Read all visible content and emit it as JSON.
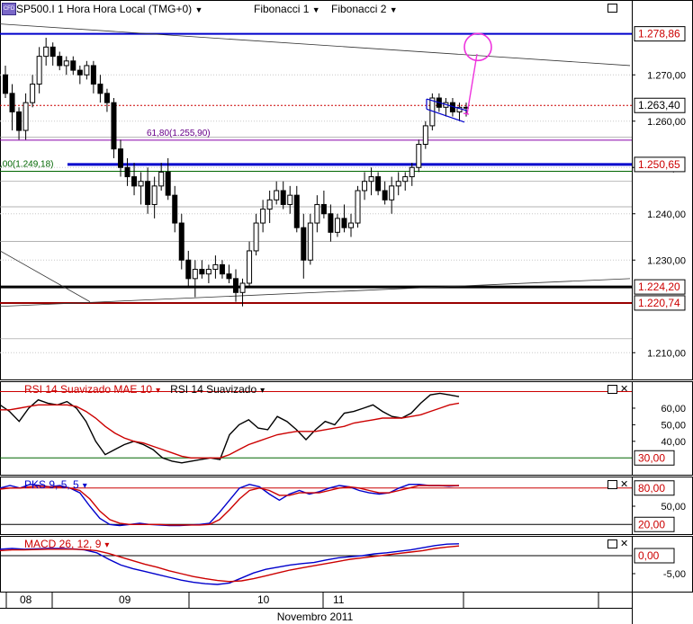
{
  "header": {
    "symbol": "SP500.I",
    "timeframe": "1 Hora",
    "timezone": "Hora Local (TMG+0)",
    "tools": [
      "Fibonacci 1",
      "Fibonacci 2"
    ]
  },
  "chart_data": [
    {
      "type": "candlestick",
      "name": "price",
      "ylim": [
        1205,
        1285
      ],
      "y_ticks": [
        1210,
        1230,
        1240,
        1250,
        1260,
        1270
      ],
      "y_tick_labels": [
        "1.210,00",
        "1.230,00",
        "1.240,00",
        "1.250,00",
        "1.260,00",
        "1.270,00"
      ],
      "price_tags": [
        {
          "label": "1.278,86",
          "value": 1278.86,
          "color": "#cc0000"
        },
        {
          "label": "1.263,40",
          "value": 1263.4,
          "color": "#000000"
        },
        {
          "label": "1.250,65",
          "value": 1250.65,
          "color": "#cc0000"
        },
        {
          "label": "1.224,20",
          "value": 1224.2,
          "color": "#cc0000"
        },
        {
          "label": "1.220,74",
          "value": 1220.74,
          "color": "#cc0000"
        }
      ],
      "horizontal_lines": [
        {
          "value": 1278.86,
          "color": "#0000cc",
          "width": 2
        },
        {
          "value": 1263.4,
          "color": "#cc0000",
          "style": "dotted"
        },
        {
          "value": 1250.65,
          "color": "#0000cc",
          "width": 3,
          "x_start": 75
        },
        {
          "value": 1224.2,
          "color": "#000000",
          "width": 3
        },
        {
          "value": 1220.74,
          "color": "#990000",
          "width": 2
        },
        {
          "value": 1255.9,
          "color": "#8800aa",
          "width": 1,
          "x_start": 0
        },
        {
          "value": 1249.18,
          "color": "#006600",
          "width": 1
        }
      ],
      "fib_labels": [
        {
          "text": "61,80(1.255,90)",
          "value": 1255.9,
          "color": "#660088"
        },
        {
          "text": ",00(1.249,18)",
          "value": 1249.18,
          "color": "#006600"
        }
      ],
      "candles": [
        [
          1270,
          1272,
          1265,
          1266
        ],
        [
          1266,
          1268,
          1258,
          1262
        ],
        [
          1262,
          1263,
          1256,
          1258
        ],
        [
          1258,
          1266,
          1256,
          1264
        ],
        [
          1264,
          1270,
          1263,
          1268
        ],
        [
          1268,
          1276,
          1266,
          1274
        ],
        [
          1274,
          1278,
          1272,
          1276
        ],
        [
          1276,
          1277,
          1272,
          1274
        ],
        [
          1274,
          1275,
          1271,
          1272
        ],
        [
          1272,
          1274,
          1270,
          1273
        ],
        [
          1273,
          1274,
          1270,
          1271
        ],
        [
          1271,
          1272,
          1268,
          1270
        ],
        [
          1270,
          1273,
          1269,
          1272
        ],
        [
          1272,
          1273,
          1266,
          1268
        ],
        [
          1268,
          1270,
          1264,
          1266
        ],
        [
          1266,
          1267,
          1262,
          1264
        ],
        [
          1264,
          1265,
          1252,
          1254
        ],
        [
          1254,
          1256,
          1248,
          1250
        ],
        [
          1250,
          1252,
          1246,
          1248
        ],
        [
          1248,
          1251,
          1244,
          1246
        ],
        [
          1246,
          1249,
          1242,
          1247
        ],
        [
          1247,
          1250,
          1240,
          1242
        ],
        [
          1242,
          1248,
          1239,
          1246
        ],
        [
          1246,
          1251,
          1245,
          1249
        ],
        [
          1249,
          1252,
          1243,
          1244
        ],
        [
          1244,
          1246,
          1236,
          1238
        ],
        [
          1238,
          1240,
          1228,
          1230
        ],
        [
          1230,
          1232,
          1224,
          1226
        ],
        [
          1226,
          1230,
          1222,
          1228
        ],
        [
          1228,
          1230,
          1226,
          1227
        ],
        [
          1227,
          1229,
          1225,
          1228
        ],
        [
          1228,
          1231,
          1226,
          1229
        ],
        [
          1229,
          1230,
          1226,
          1227
        ],
        [
          1227,
          1229,
          1225,
          1226
        ],
        [
          1226,
          1228,
          1221,
          1223
        ],
        [
          1223,
          1226,
          1220,
          1225
        ],
        [
          1225,
          1234,
          1224,
          1232
        ],
        [
          1232,
          1240,
          1231,
          1238
        ],
        [
          1238,
          1243,
          1236,
          1241
        ],
        [
          1241,
          1245,
          1238,
          1243
        ],
        [
          1243,
          1247,
          1242,
          1245
        ],
        [
          1245,
          1247,
          1241,
          1242
        ],
        [
          1242,
          1246,
          1240,
          1244
        ],
        [
          1244,
          1246,
          1236,
          1237
        ],
        [
          1237,
          1240,
          1226,
          1230
        ],
        [
          1230,
          1240,
          1229,
          1238
        ],
        [
          1238,
          1244,
          1236,
          1242
        ],
        [
          1242,
          1245,
          1239,
          1240
        ],
        [
          1240,
          1242,
          1234,
          1236
        ],
        [
          1236,
          1240,
          1235,
          1239
        ],
        [
          1239,
          1242,
          1236,
          1237
        ],
        [
          1237,
          1240,
          1235,
          1238
        ],
        [
          1238,
          1246,
          1237,
          1245
        ],
        [
          1245,
          1249,
          1243,
          1247
        ],
        [
          1247,
          1250,
          1244,
          1248
        ],
        [
          1248,
          1249,
          1244,
          1245
        ],
        [
          1245,
          1247,
          1242,
          1243
        ],
        [
          1243,
          1248,
          1240,
          1246
        ],
        [
          1246,
          1249,
          1244,
          1247
        ],
        [
          1247,
          1249,
          1245,
          1248
        ],
        [
          1248,
          1251,
          1246,
          1250
        ],
        [
          1250,
          1256,
          1249,
          1255
        ],
        [
          1255,
          1260,
          1254,
          1259
        ],
        [
          1259,
          1266,
          1258,
          1265
        ],
        [
          1265,
          1266,
          1262,
          1263
        ],
        [
          1263,
          1265,
          1261,
          1264
        ],
        [
          1264,
          1265,
          1261,
          1262
        ],
        [
          1262,
          1264,
          1260,
          1263
        ],
        [
          1263,
          1264,
          1261,
          1263
        ]
      ],
      "trend_lines": [
        {
          "from": [
            0,
            1281
          ],
          "to": [
            700,
            1272
          ],
          "color": "#333333"
        },
        {
          "from": [
            0,
            1220
          ],
          "to": [
            700,
            1226
          ],
          "color": "#333333"
        },
        {
          "from": [
            0,
            1232
          ],
          "to": [
            100,
            1221
          ],
          "color": "#333333"
        }
      ],
      "flag_channel": {
        "upper": [
          [
            474,
            1264.8
          ],
          [
            520,
            1262.2
          ]
        ],
        "lower": [
          [
            474,
            1262.6
          ],
          [
            516,
            1259.8
          ]
        ],
        "color": "#0000cc"
      },
      "projection": {
        "from": [
          519,
          1261.5
        ],
        "to": [
          530,
          1274.5
        ],
        "circle_center": [
          531,
          1276.0
        ],
        "circle_radius": 15,
        "color": "#ee33dd"
      }
    },
    {
      "type": "line",
      "name": "rsi",
      "title_parts": [
        "RSI 14 Suavizado MAE 10",
        "RSI 14 Suavizado"
      ],
      "title_colors": [
        "#cc0000",
        "#000000"
      ],
      "ylim": [
        22,
        73
      ],
      "y_ticks": [
        40,
        50,
        60
      ],
      "y_tick_labels": [
        "40,00",
        "50,00",
        "60,00"
      ],
      "level_tags": [
        {
          "label": "30,00",
          "value": 30,
          "color": "#cc0000"
        }
      ],
      "levels": [
        {
          "value": 70,
          "color": "#cc0000"
        },
        {
          "value": 30,
          "color": "#006600"
        }
      ],
      "series": [
        {
          "color": "#000000",
          "values": [
            62,
            58,
            52,
            60,
            65,
            63,
            62,
            64,
            60,
            52,
            40,
            32,
            35,
            38,
            40,
            38,
            35,
            30,
            28,
            27,
            28,
            29,
            30,
            29,
            44,
            50,
            53,
            48,
            47,
            55,
            52,
            47,
            41,
            47,
            52,
            50,
            57,
            58,
            60,
            62,
            58,
            55,
            54,
            57,
            63,
            68,
            69,
            68,
            67
          ]
        },
        {
          "color": "#cc0000",
          "values": [
            59,
            59,
            60,
            61,
            62,
            62,
            62,
            62,
            61,
            58,
            54,
            49,
            45,
            42,
            40,
            39,
            37,
            35,
            33,
            31,
            30,
            30,
            30,
            30,
            32,
            35,
            38,
            40,
            42,
            44,
            45,
            46,
            46,
            46,
            47,
            48,
            49,
            51,
            52,
            53,
            54,
            54,
            54,
            55,
            56,
            58,
            60,
            62,
            63
          ]
        }
      ]
    },
    {
      "type": "line",
      "name": "pks",
      "title_parts": [
        "PKS 9, 5, 5"
      ],
      "title_colors": [
        "#0000cc"
      ],
      "ylim": [
        10,
        90
      ],
      "y_ticks": [
        50
      ],
      "y_tick_labels": [
        "50,00"
      ],
      "level_tags": [
        {
          "label": "80,00",
          "value": 80,
          "color": "#cc0000"
        },
        {
          "label": "20,00",
          "value": 20,
          "color": "#cc0000"
        }
      ],
      "levels": [
        {
          "value": 80,
          "color": "#cc0000"
        },
        {
          "value": 20,
          "color": "#000000"
        }
      ],
      "series": [
        {
          "color": "#0000cc",
          "values": [
            80,
            84,
            80,
            86,
            84,
            82,
            84,
            80,
            72,
            50,
            30,
            20,
            18,
            20,
            22,
            20,
            19,
            18,
            18,
            19,
            20,
            22,
            40,
            60,
            80,
            86,
            82,
            70,
            60,
            70,
            76,
            70,
            74,
            80,
            84,
            82,
            76,
            72,
            70,
            72,
            80,
            86,
            86,
            84,
            84,
            83,
            84
          ]
        },
        {
          "color": "#cc0000",
          "values": [
            78,
            80,
            80,
            82,
            83,
            82,
            82,
            80,
            76,
            62,
            42,
            28,
            22,
            20,
            20,
            20,
            20,
            19,
            19,
            19,
            19,
            20,
            28,
            44,
            62,
            76,
            80,
            76,
            68,
            68,
            72,
            72,
            72,
            76,
            80,
            82,
            80,
            76,
            72,
            72,
            76,
            80,
            84,
            84,
            84,
            84,
            84
          ]
        }
      ]
    },
    {
      "type": "line",
      "name": "macd",
      "title_parts": [
        "MACD 26, 12, 9"
      ],
      "title_colors": [
        "#cc0000"
      ],
      "ylim": [
        -9,
        4
      ],
      "y_ticks": [
        -5
      ],
      "y_tick_labels": [
        "-5,00"
      ],
      "level_tags": [
        {
          "label": "0,00",
          "value": 0,
          "color": "#cc0000"
        }
      ],
      "levels": [
        {
          "value": 0,
          "color": "#000000"
        }
      ],
      "series": [
        {
          "color": "#0000cc",
          "values": [
            1.8,
            2.0,
            1.8,
            1.9,
            2.0,
            2.0,
            1.9,
            1.6,
            0.8,
            -1.0,
            -2.6,
            -3.6,
            -4.4,
            -5.2,
            -6.0,
            -6.8,
            -7.4,
            -7.8,
            -8.0,
            -7.6,
            -6.2,
            -4.8,
            -3.8,
            -3.2,
            -2.6,
            -2.2,
            -1.9,
            -1.2,
            -0.6,
            -0.3,
            0.0,
            0.5,
            0.8,
            1.2,
            1.6,
            2.2,
            2.8,
            3.2,
            3.3
          ]
        },
        {
          "color": "#cc0000",
          "values": [
            1.4,
            1.6,
            1.6,
            1.7,
            1.8,
            1.8,
            1.8,
            1.7,
            1.4,
            0.6,
            -0.4,
            -1.4,
            -2.4,
            -3.2,
            -4.2,
            -5.0,
            -5.8,
            -6.4,
            -6.9,
            -7.2,
            -7.0,
            -6.4,
            -5.6,
            -4.8,
            -4.0,
            -3.4,
            -2.8,
            -2.2,
            -1.6,
            -1.0,
            -0.6,
            -0.2,
            0.2,
            0.6,
            1.0,
            1.4,
            2.0,
            2.4,
            2.7
          ]
        }
      ]
    }
  ],
  "x_axis": {
    "day_labels": [
      "08",
      "09",
      "10",
      "11"
    ],
    "month_label": "Novembro 2011"
  },
  "panel_controls": [
    "restore",
    "close"
  ]
}
